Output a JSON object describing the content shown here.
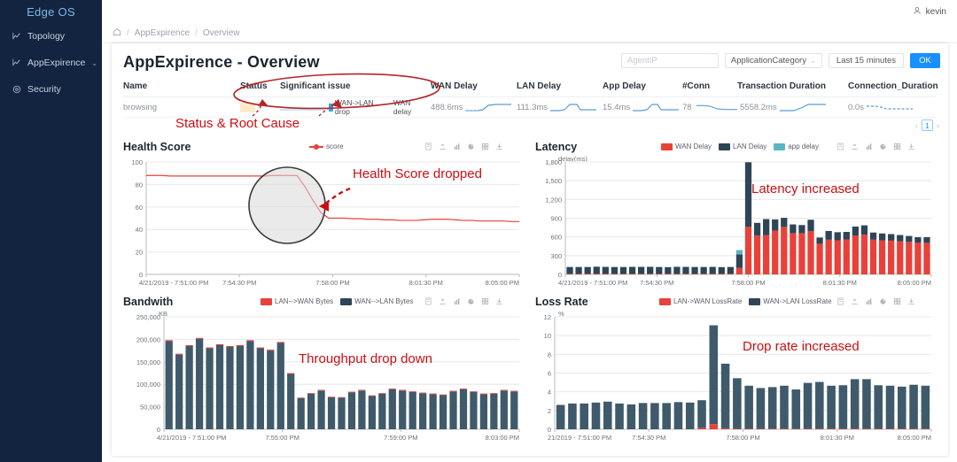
{
  "sidebar": {
    "brand": "Edge OS",
    "items": [
      {
        "label": "Topology",
        "icon": "chart-line-icon",
        "expandable": false
      },
      {
        "label": "AppExpirence",
        "icon": "chart-line-icon",
        "expandable": true,
        "chevron": "⌄"
      },
      {
        "label": "Security",
        "icon": "shield-icon",
        "expandable": false
      }
    ]
  },
  "topbar": {
    "user": "kevin",
    "user_icon": "user-icon"
  },
  "breadcrumb": {
    "home_icon": "home-icon",
    "sep": "/",
    "items": [
      "AppExpirence",
      "Overview"
    ]
  },
  "page": {
    "title": "AppExpirence - Overview"
  },
  "filters": {
    "agent_ip_value": "",
    "agent_ip_placeholder": "AgentIP",
    "category_value": "ApplicationCategory",
    "category_caret": "⌄",
    "time_range": "Last 15 minutes",
    "ok_label": "OK",
    "ok_color": "#1890ff"
  },
  "table": {
    "columns": [
      "Name",
      "Status",
      "Significant issue",
      "WAN Delay",
      "LAN Delay",
      "App Delay",
      "#Conn",
      "Transaction Duration",
      "Connection_Duration"
    ],
    "rows": [
      {
        "name": "browsing",
        "status": "warning",
        "issues": [
          "WAN->LAN drop",
          "WAN delay"
        ],
        "wan_delay": "488.6ms",
        "lan_delay": "111.3ms",
        "app_delay": "15.4ms",
        "conn": "78",
        "transaction_duration": "5558.2ms",
        "connection_duration": "0.0s"
      }
    ]
  },
  "pagination": {
    "prev": "‹",
    "page": "1",
    "next": "›"
  },
  "annotations": [
    {
      "id": "status-root-cause",
      "text": "Status & Root Cause"
    },
    {
      "id": "health-score-dropped",
      "text": "Health Score dropped"
    },
    {
      "id": "latency-increased",
      "text": "Latency increased"
    },
    {
      "id": "throughput-drop-down",
      "text": "Throughput drop down"
    },
    {
      "id": "drop-rate-increased",
      "text": "Drop rate increased"
    }
  ],
  "panel_tools": [
    "document-icon",
    "export-icon",
    "bar-chart-icon",
    "pie-chart-icon",
    "grid-icon",
    "download-icon"
  ],
  "chart_data": [
    {
      "id": "health-score",
      "type": "line",
      "title": "Health Score",
      "ylabel": "",
      "xlabel": "",
      "ylim": [
        0,
        100
      ],
      "yticks": [
        0,
        20,
        40,
        60,
        80,
        100
      ],
      "ytick_labels": [
        "0",
        "20",
        "40",
        "60",
        "80",
        "100"
      ],
      "xtick_labels": [
        "4/21/2019 - 7:51:00 PM",
        "7:54:30 PM",
        "7:58:00 PM",
        "8:01:30 PM",
        "8:05:00 PM"
      ],
      "legend": [
        {
          "name": "score",
          "color": "#e8413a",
          "marker": "dot-line"
        }
      ],
      "legend_position": "top-center",
      "grid": true,
      "series": [
        {
          "name": "score",
          "color": "#e8413a",
          "values": [
            88,
            88,
            88,
            87.5,
            87.5,
            87.5,
            87.5,
            87.5,
            87.5,
            87.5,
            87.5,
            87.5,
            87.5,
            87.5,
            87.5,
            87.5,
            88,
            88,
            88,
            88,
            78,
            66,
            55,
            50,
            50,
            50,
            49.5,
            49.5,
            49,
            49,
            48.5,
            48.5,
            48,
            48,
            48,
            48.5,
            49,
            49,
            49,
            48.5,
            48,
            48,
            47.5,
            47.5,
            47.5,
            47.5,
            47,
            47
          ]
        }
      ]
    },
    {
      "id": "latency",
      "type": "bar",
      "stacked": true,
      "title": "Latency",
      "ylabel": "delay(ms)",
      "xlabel": "",
      "ylim": [
        0,
        1800
      ],
      "yticks": [
        0,
        300,
        600,
        900,
        1200,
        1500,
        1800
      ],
      "ytick_labels": [
        "0",
        "300",
        "600",
        "900",
        "1,200",
        "1,500",
        "1,800"
      ],
      "xtick_labels": [
        "4/21/2019 - 7:51:00 PM",
        "7:54:30 PM",
        "7:58:00 PM",
        "8:01:30 PM",
        "8:05:00 PM"
      ],
      "legend": [
        {
          "name": "WAN Delay",
          "color": "#e8413a"
        },
        {
          "name": "LAN Delay",
          "color": "#2e4556"
        },
        {
          "name": "app delay",
          "color": "#59b6c4"
        }
      ],
      "legend_position": "top-center",
      "grid": true,
      "series": [
        {
          "name": "WAN Delay",
          "color": "#e8413a",
          "values": [
            8,
            8,
            8,
            8,
            8,
            8,
            8,
            8,
            8,
            8,
            8,
            8,
            8,
            8,
            8,
            8,
            8,
            8,
            8,
            105,
            760,
            620,
            630,
            700,
            760,
            660,
            660,
            690,
            490,
            555,
            545,
            560,
            620,
            635,
            555,
            545,
            540,
            530,
            520,
            505,
            505
          ]
        },
        {
          "name": "LAN Delay",
          "color": "#2e4556",
          "values": [
            110,
            110,
            110,
            115,
            112,
            110,
            110,
            112,
            112,
            113,
            110,
            108,
            113,
            112,
            110,
            110,
            112,
            108,
            110,
            215,
            1035,
            205,
            255,
            180,
            145,
            140,
            130,
            185,
            100,
            140,
            130,
            120,
            145,
            150,
            115,
            110,
            105,
            100,
            95,
            90,
            90
          ]
        },
        {
          "name": "app delay",
          "color": "#59b6c4",
          "values": [
            0,
            0,
            0,
            0,
            0,
            0,
            0,
            0,
            0,
            0,
            0,
            0,
            0,
            0,
            0,
            0,
            0,
            0,
            0,
            70,
            0,
            0,
            0,
            0,
            0,
            0,
            0,
            0,
            0,
            0,
            0,
            0,
            0,
            0,
            0,
            0,
            0,
            0,
            0,
            0,
            0
          ]
        }
      ]
    },
    {
      "id": "bandwith",
      "type": "bar",
      "stacked": true,
      "title": "Bandwith",
      "ylabel": "KB",
      "xlabel": "",
      "ylim": [
        0,
        250000
      ],
      "yticks": [
        0,
        50000,
        100000,
        150000,
        200000,
        250000
      ],
      "ytick_labels": [
        "0",
        "50,000",
        "100,000",
        "150,000",
        "200,000",
        "250,000"
      ],
      "xtick_labels": [
        "4/21/2019 - 7:51:00 PM",
        "7:55:00 PM",
        "7:59:00 PM",
        "8:03:00 PM"
      ],
      "legend": [
        {
          "name": "LAN-->WAN Bytes",
          "color": "#e8413a"
        },
        {
          "name": "WAN-->LAN Bytes",
          "color": "#2e4556"
        }
      ],
      "legend_position": "top-center",
      "grid": true,
      "series": [
        {
          "name": "WAN-->LAN Bytes",
          "color": "#3f5a6b",
          "values": [
            196000,
            166000,
            185000,
            201000,
            180000,
            187000,
            183000,
            185000,
            196000,
            180000,
            175000,
            192000,
            123000,
            69000,
            79000,
            86000,
            71000,
            70000,
            82000,
            86000,
            74000,
            79000,
            89000,
            86000,
            83000,
            80000,
            78000,
            76000,
            84000,
            89000,
            83000,
            78000,
            79000,
            86000,
            84000
          ]
        },
        {
          "name": "LAN-->WAN Bytes",
          "color": "#e8413a",
          "values": [
            2200,
            2000,
            2100,
            2200,
            2000,
            2100,
            2100,
            2100,
            2200,
            2000,
            2000,
            2100,
            1800,
            1400,
            1500,
            1600,
            1400,
            1400,
            1500,
            1600,
            1400,
            1500,
            1600,
            1600,
            1500,
            1500,
            1500,
            1400,
            1600,
            1600,
            1500,
            1500,
            1500,
            1600,
            1500
          ]
        }
      ]
    },
    {
      "id": "loss-rate",
      "type": "bar",
      "stacked": true,
      "title": "Loss Rate",
      "ylabel": "%",
      "xlabel": "",
      "ylim": [
        0,
        12
      ],
      "yticks": [
        0,
        2,
        4,
        6,
        8,
        10,
        12
      ],
      "ytick_labels": [
        "0",
        "2",
        "4",
        "6",
        "8",
        "10",
        "12"
      ],
      "xtick_labels": [
        "21/2019 - 7:51:00 PM",
        "7:54:30 PM",
        "7:58:00 PM",
        "8:01:30 PM",
        "8:05:00 PM"
      ],
      "legend": [
        {
          "name": "LAN->WAN LossRate",
          "color": "#e8413a"
        },
        {
          "name": "WAN->LAN LossRate",
          "color": "#2e4556"
        }
      ],
      "legend_position": "top-center",
      "grid": true,
      "series": [
        {
          "name": "LAN->WAN LossRate",
          "color": "#e8413a",
          "values": [
            0,
            0,
            0,
            0,
            0,
            0,
            0,
            0,
            0,
            0,
            0,
            0,
            0.15,
            0.55,
            0.1,
            0.05,
            0.05,
            0.05,
            0.05,
            0.05,
            0.05,
            0.05,
            0.05,
            0.05,
            0.05,
            0.05,
            0.05,
            0.05,
            0.05,
            0.05,
            0.05,
            0.05
          ]
        },
        {
          "name": "WAN->LAN LossRate",
          "color": "#3f5a6b",
          "values": [
            2.6,
            2.75,
            2.75,
            2.85,
            2.95,
            2.75,
            2.65,
            2.8,
            2.8,
            2.8,
            2.9,
            2.85,
            2.95,
            10.55,
            6.9,
            5.4,
            4.6,
            4.35,
            4.45,
            4.6,
            4.2,
            4.9,
            5.0,
            4.6,
            4.65,
            5.3,
            5.3,
            4.65,
            4.6,
            4.5,
            4.7,
            4.6
          ]
        }
      ]
    }
  ]
}
